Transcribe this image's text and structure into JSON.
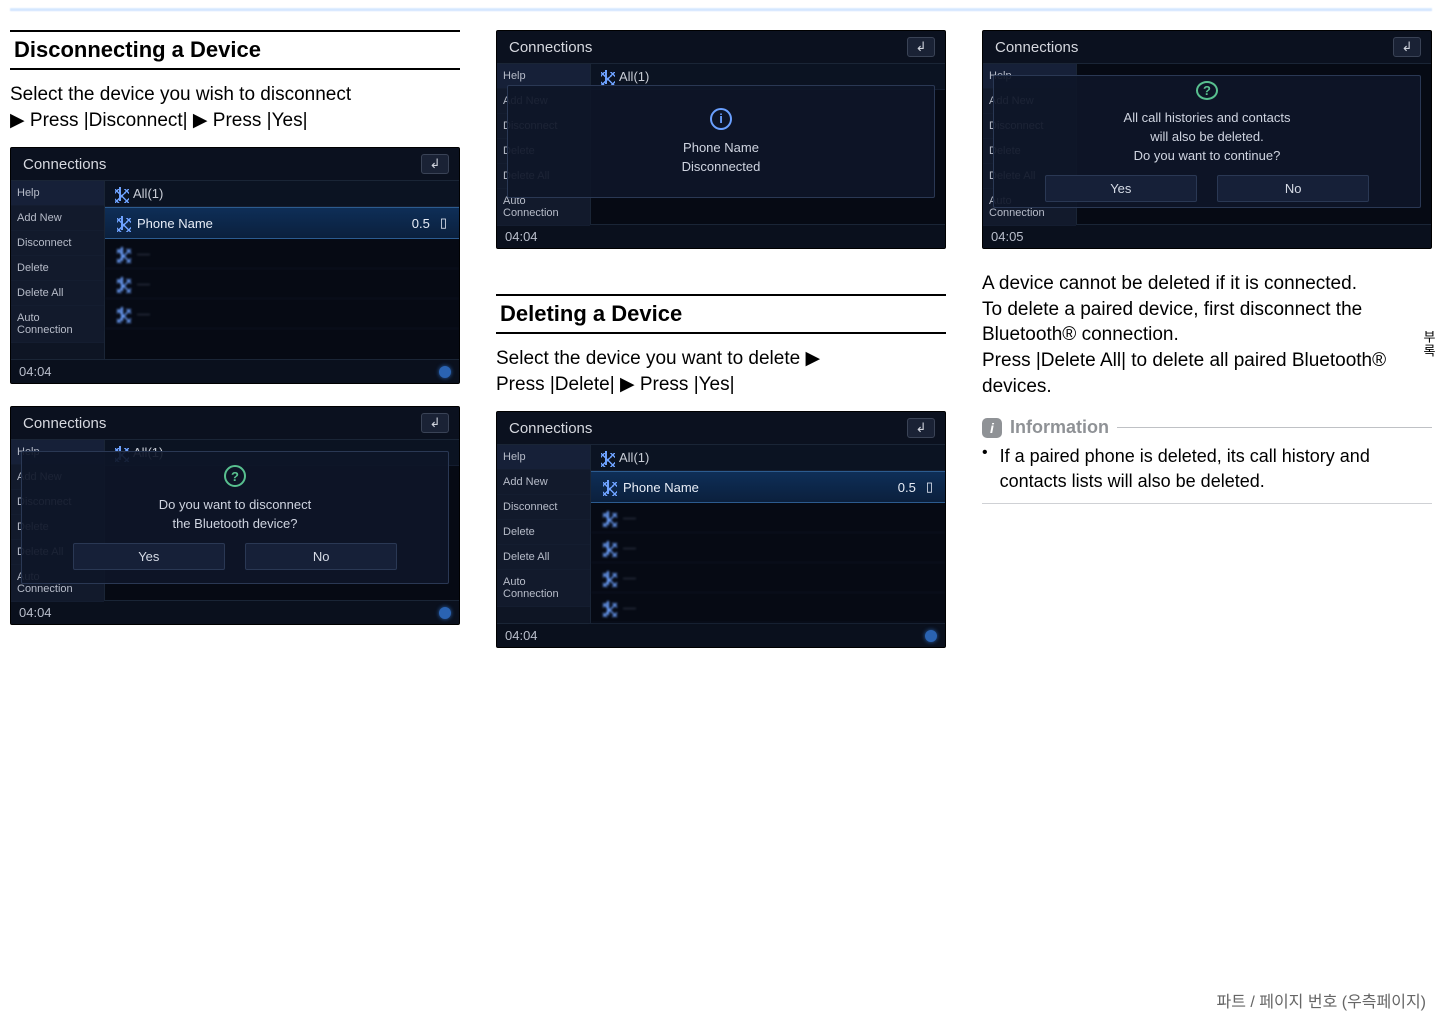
{
  "top": {},
  "col1": {
    "h1": "Disconnecting a Device",
    "lead_line1": "Select the device you wish to disconnect",
    "lead_line2_a": "▶ Press ",
    "lead_btn1": "|Disconnect|",
    "lead_line2_b": " ▶ Press ",
    "lead_btn2": "|Yes|"
  },
  "shot_common": {
    "title": "Connections",
    "back_glyph": "↲",
    "side": [
      "Help",
      "Add New",
      "Disconnect",
      "Delete",
      "Delete All",
      "Auto Connection"
    ],
    "list_header": "All(1)",
    "row_sel": "Phone Name",
    "row_sel_right": "0.5",
    "time_0404": "04:04",
    "time_0405": "04:05"
  },
  "shot1b_modal": {
    "icon": "?",
    "line1": "Do you want to disconnect",
    "line2": "the Bluetooth device?",
    "yes": "Yes",
    "no": "No"
  },
  "shot2a_modal": {
    "icon": "i",
    "line1": "Phone Name",
    "line2": "Disconnected"
  },
  "col2": {
    "h1": "Deleting a Device",
    "lead_a": "Select the device you want to delete ▶",
    "lead_b_a": "Press ",
    "lead_btn1": "|Delete|",
    "lead_b_b": " ▶ Press ",
    "lead_btn2": "|Yes|"
  },
  "shot3b_modal": {
    "icon": "?",
    "line1": "All call histories and contacts",
    "line2": "will also be deleted.",
    "line3": "Do you want to continue?",
    "yes": "Yes",
    "no": "No"
  },
  "col3": {
    "p1": "A device cannot be deleted if it is connected.",
    "p2": "To delete a paired device, first disconnect the Bluetooth® connection.",
    "p3_a": "Press ",
    "p3_btn": "|Delete All|",
    "p3_b": " to delete all paired Bluetooth® devices."
  },
  "info": {
    "badge": "i",
    "title": "Information",
    "bullet": "If a paired phone is deleted, its call history and contacts lists will also be deleted."
  },
  "side_tab": "부록",
  "footer": "파트 / 페이지 번호 (우측페이지)"
}
